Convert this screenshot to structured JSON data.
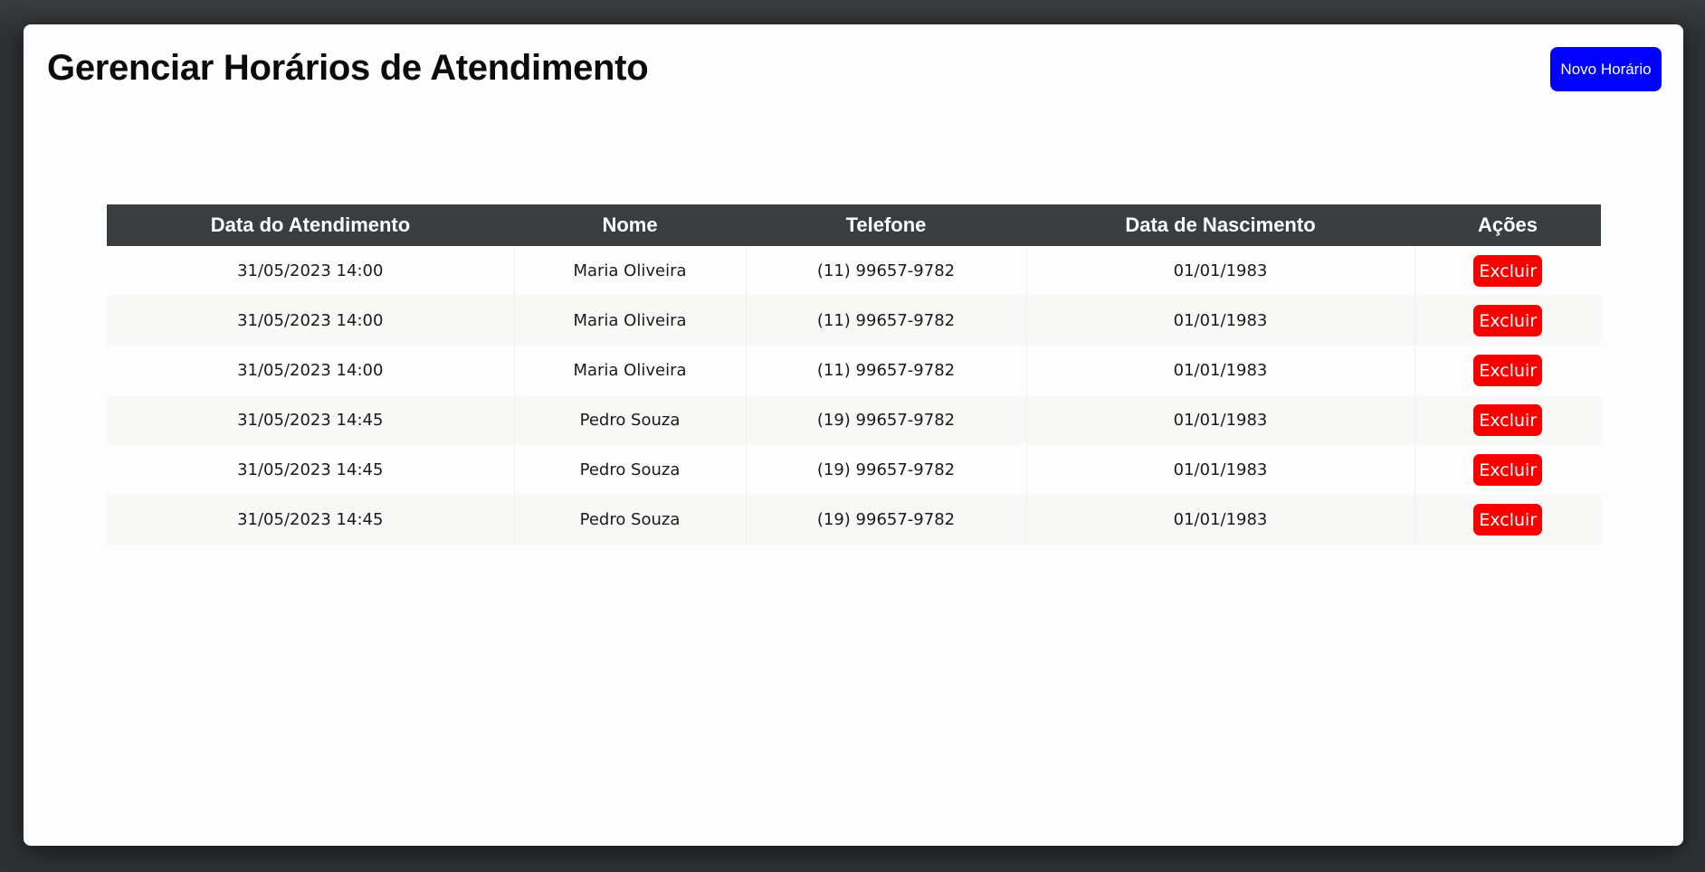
{
  "page": {
    "title": "Gerenciar Horários de Atendimento",
    "new_button_label": "Novo Horário"
  },
  "colors": {
    "new_button": "#0000ff",
    "delete_button": "#f60000",
    "table_header_bg": "#3a3e41"
  },
  "table": {
    "headers": [
      "Data do Atendimento",
      "Nome",
      "Telefone",
      "Data de Nascimento",
      "Ações"
    ],
    "rows": [
      {
        "data_atendimento": "31/05/2023 14:00",
        "nome": "Maria Oliveira",
        "telefone": "(11) 99657-9782",
        "data_nascimento": "01/01/1983",
        "acao": "Excluir"
      },
      {
        "data_atendimento": "31/05/2023 14:00",
        "nome": "Maria Oliveira",
        "telefone": "(11) 99657-9782",
        "data_nascimento": "01/01/1983",
        "acao": "Excluir"
      },
      {
        "data_atendimento": "31/05/2023 14:00",
        "nome": "Maria Oliveira",
        "telefone": "(11) 99657-9782",
        "data_nascimento": "01/01/1983",
        "acao": "Excluir"
      },
      {
        "data_atendimento": "31/05/2023 14:45",
        "nome": "Pedro Souza",
        "telefone": "(19) 99657-9782",
        "data_nascimento": "01/01/1983",
        "acao": "Excluir"
      },
      {
        "data_atendimento": "31/05/2023 14:45",
        "nome": "Pedro Souza",
        "telefone": "(19) 99657-9782",
        "data_nascimento": "01/01/1983",
        "acao": "Excluir"
      },
      {
        "data_atendimento": "31/05/2023 14:45",
        "nome": "Pedro Souza",
        "telefone": "(19) 99657-9782",
        "data_nascimento": "01/01/1983",
        "acao": "Excluir"
      }
    ]
  }
}
